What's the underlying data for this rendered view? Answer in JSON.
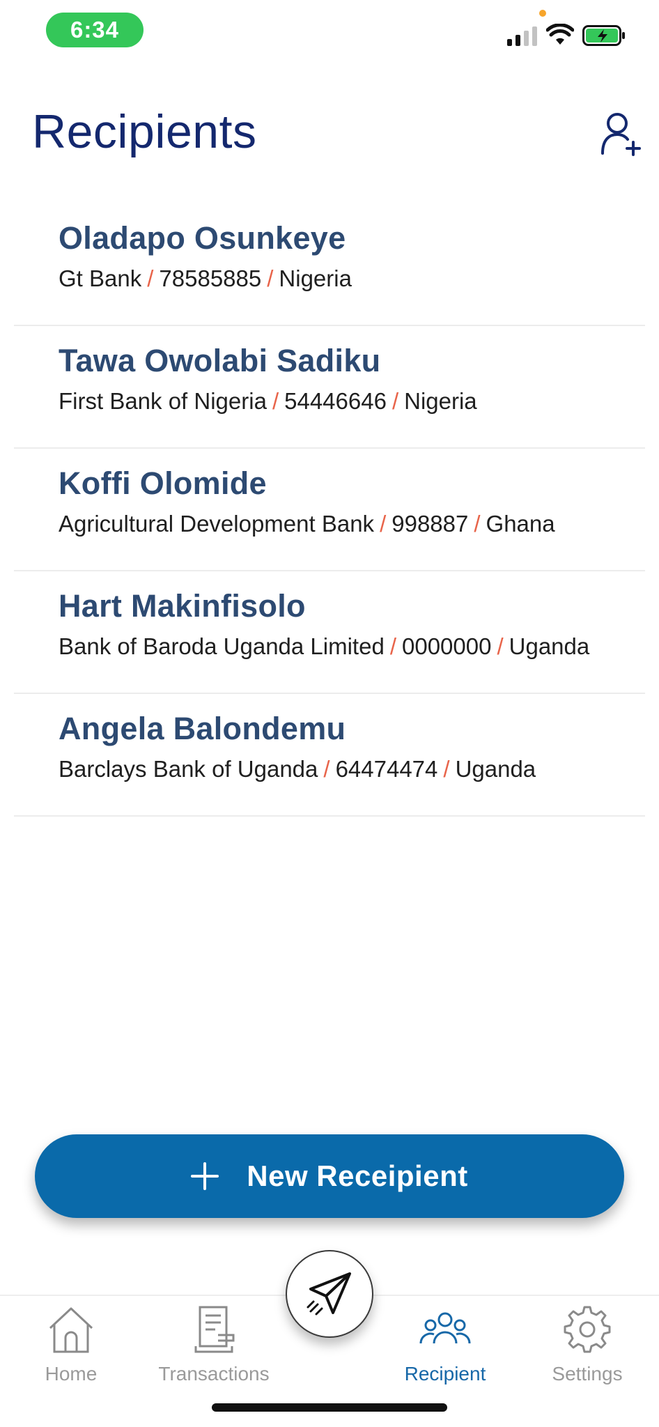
{
  "status_bar": {
    "time": "6:34"
  },
  "header": {
    "title": "Recipients",
    "add_icon": "add-person-icon"
  },
  "recipients": [
    {
      "name": "Oladapo Osunkeye",
      "bank": "Gt Bank",
      "account": "78585885",
      "country": "Nigeria"
    },
    {
      "name": "Tawa Owolabi Sadiku",
      "bank": "First Bank of Nigeria",
      "account": "54446646",
      "country": "Nigeria"
    },
    {
      "name": "Koffi Olomide",
      "bank": "Agricultural Development Bank",
      "account": "998887",
      "country": "Ghana"
    },
    {
      "name": "Hart Makinfisolo",
      "bank": "Bank of Baroda Uganda Limited",
      "account": "0000000",
      "country": "Uganda"
    },
    {
      "name": "Angela Balondemu",
      "bank": "Barclays Bank of Uganda",
      "account": "64474474",
      "country": "Uganda"
    }
  ],
  "separator": "/",
  "new_button": {
    "label": "New Receipient",
    "icon": "plus-icon"
  },
  "nav": {
    "home": "Home",
    "transactions": "Transactions",
    "recipient": "Recipient",
    "settings": "Settings",
    "send_icon": "paper-plane-icon"
  },
  "colors": {
    "title": "#14286e",
    "name": "#2d4a72",
    "accent": "#0a6aaa",
    "separator": "#e8644a",
    "active_nav": "#1768a8"
  }
}
